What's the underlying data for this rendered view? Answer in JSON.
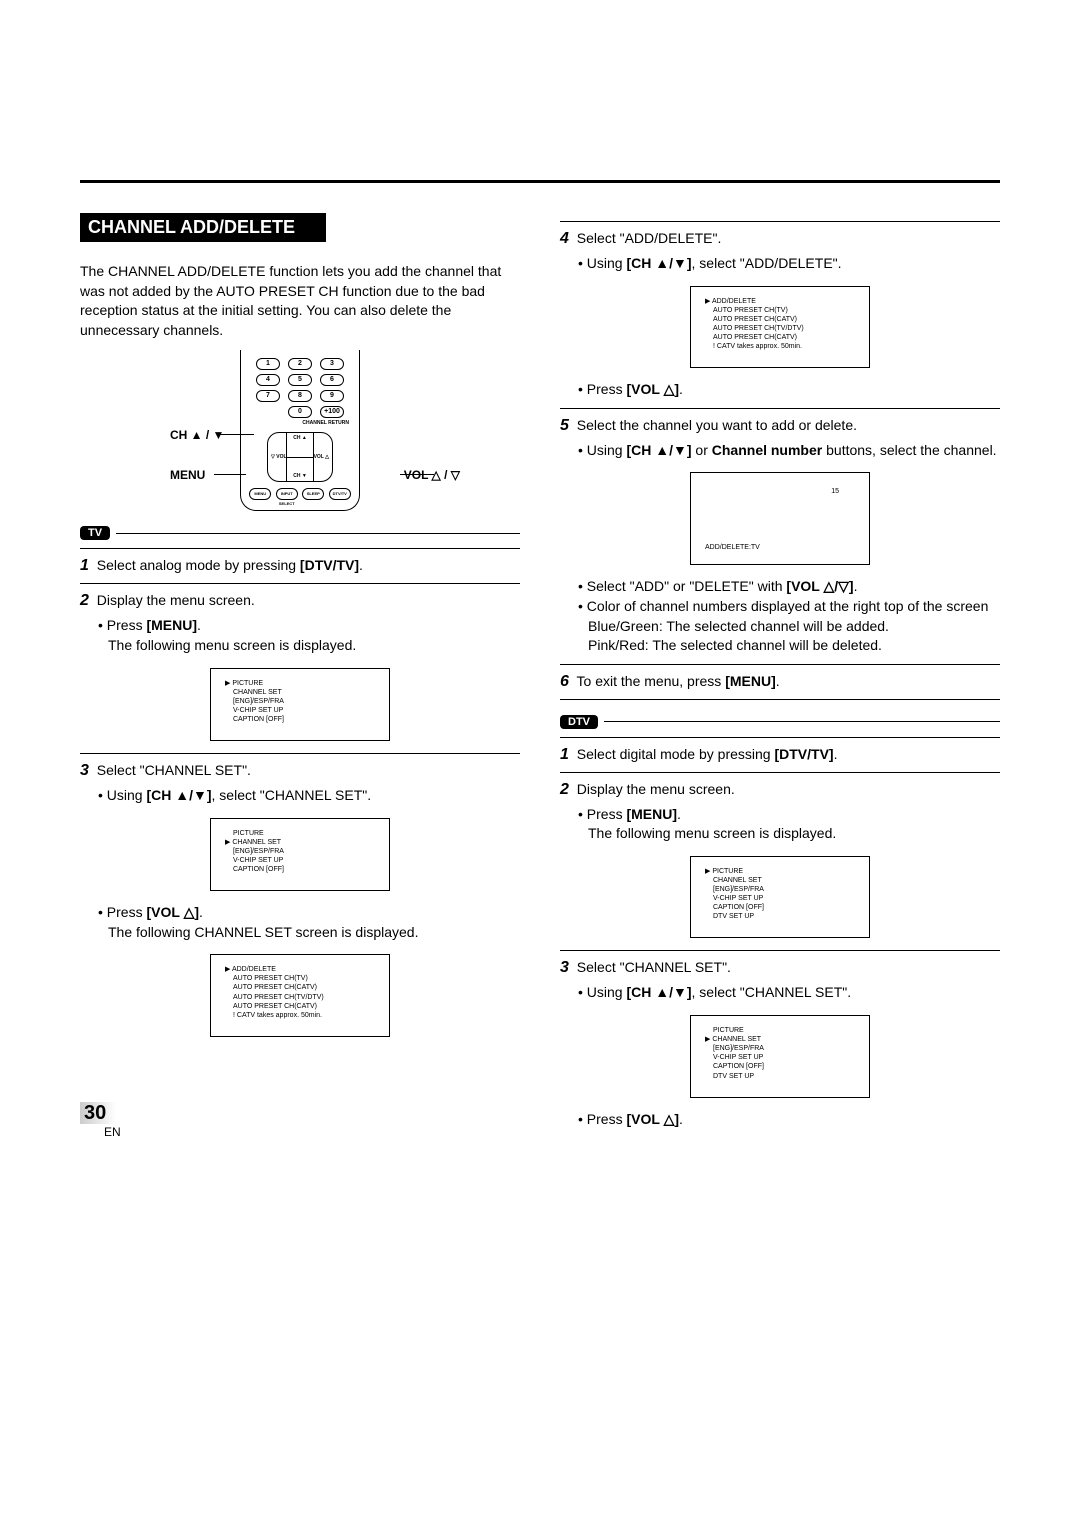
{
  "title": "CHANNEL ADD/DELETE",
  "intro": "The CHANNEL ADD/DELETE function lets you add the channel that was not added by the AUTO PRESET CH function due to the bad reception status at the initial setting. You can also delete the unnecessary channels.",
  "remote_labels": {
    "ch": "CH ▲ / ▼",
    "menu": "MENU",
    "vol": "VOL △ / ▽"
  },
  "remote_keys": [
    "1",
    "2",
    "3",
    "4",
    "5",
    "6",
    "7",
    "8",
    "9",
    "",
    "0",
    "+100"
  ],
  "remote_tiny": {
    "channel_return": "CHANNEL RETURN",
    "vol_left": "▽ VOL",
    "vol_right": "VOL △",
    "ch_up": "CH ▲",
    "ch_down": "CH ▼",
    "menu": "MENU",
    "input": "INPUT SELECT",
    "sleep": "SLEEP",
    "dtvtv": "DTV/TV"
  },
  "tag_tv": "TV",
  "tag_dtv": "DTV",
  "tv_steps": {
    "s1": "Select analog mode by pressing [DTV/TV].",
    "s2": "Display the menu screen.",
    "s2a": "Press [MENU].",
    "s2b": "The following menu screen is displayed.",
    "s3": "Select \"CHANNEL SET\".",
    "s3a": "Using [CH ▲/▼], select \"CHANNEL SET\".",
    "s3c": "Press [VOL △].",
    "s3d": "The following CHANNEL SET screen is displayed."
  },
  "right_steps": {
    "s4": "Select \"ADD/DELETE\".",
    "s4a": "Using [CH ▲/▼], select \"ADD/DELETE\".",
    "s4c": "Press [VOL △].",
    "s5": "Select the channel you want to add or delete.",
    "s5a": "Using [CH ▲/▼] or Channel number buttons, select the channel.",
    "s5c": "Select \"ADD\" or \"DELETE\" with [VOL △/▽].",
    "s5d": "Color of channel numbers displayed at the right top of the screen",
    "s5e": "Blue/Green: The selected channel will be added.",
    "s5f": "Pink/Red: The selected channel will be deleted.",
    "s6": "To exit the menu, press [MENU]."
  },
  "dtv_steps": {
    "s1": "Select digital mode by pressing [DTV/TV].",
    "s2": "Display the menu screen.",
    "s2a": "Press [MENU].",
    "s2b": "The following menu screen is displayed.",
    "s3": "Select \"CHANNEL SET\".",
    "s3a": "Using [CH ▲/▼], select \"CHANNEL SET\".",
    "s3c": "Press [VOL △]."
  },
  "menus": {
    "main_tv": [
      "▶ PICTURE",
      "CHANNEL SET",
      "[ENG]/ESP/FRA",
      "V-CHIP SET UP",
      "CAPTION [OFF]"
    ],
    "main_tv_sel": [
      "PICTURE",
      "▶ CHANNEL SET",
      "[ENG]/ESP/FRA",
      "V-CHIP SET UP",
      "CAPTION [OFF]"
    ],
    "channel_set": [
      "▶ ADD/DELETE",
      "AUTO PRESET CH(TV)",
      "AUTO PRESET CH(CATV)",
      "AUTO PRESET CH(TV/DTV)",
      "AUTO PRESET CH(CATV)",
      "! CATV takes approx. 50min."
    ],
    "add_delete_tv": {
      "num": "15",
      "label": "ADD/DELETE:TV"
    },
    "main_dtv": [
      "▶ PICTURE",
      "CHANNEL SET",
      "[ENG]/ESP/FRA",
      "V-CHIP SET UP",
      "CAPTION [OFF]",
      "DTV SET UP"
    ],
    "main_dtv_sel": [
      "PICTURE",
      "▶ CHANNEL SET",
      "[ENG]/ESP/FRA",
      "V-CHIP SET UP",
      "CAPTION [OFF]",
      "DTV SET UP"
    ]
  },
  "bold_tokens": {
    "dtvtv": "[DTV/TV]",
    "menu": "[MENU]",
    "chupdown": "[CH ▲/▼]",
    "volup": "[VOL △]",
    "volupdown": "[VOL △/▽]",
    "channelnum": "Channel number"
  },
  "page_number": "30",
  "page_lang": "EN"
}
